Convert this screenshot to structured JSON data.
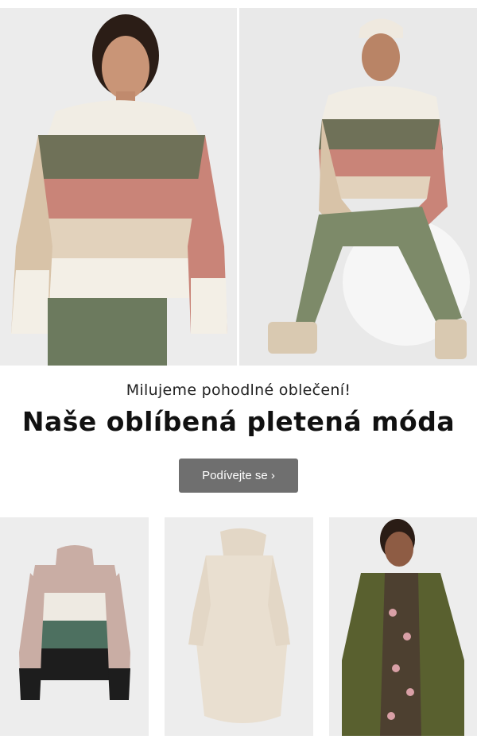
{
  "hero": {
    "images": [
      {
        "icon": "model-striped-sweater-front-photo"
      },
      {
        "icon": "model-striped-sweater-seated-photo"
      }
    ]
  },
  "promo": {
    "subtitle": "Milujeme pohodlné oblečení!",
    "headline": "Naše oblíbená pletená móda",
    "cta_label": "Podívejte se ›"
  },
  "products": [
    {
      "icon": "colorblock-turtleneck-sweater-photo"
    },
    {
      "icon": "beige-knit-dress-photo"
    },
    {
      "icon": "olive-cardigan-floral-dress-photo"
    }
  ],
  "colors": {
    "button": "#6f6f6f",
    "headline": "#111111",
    "photo_bg": "#eeeeee"
  }
}
